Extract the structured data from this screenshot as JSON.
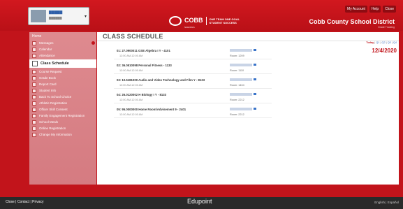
{
  "header": {
    "logo_name": "COBB",
    "logo_sub": "SCHOOLS",
    "logo_tagline": [
      "ONE TEAM ONE GOAL",
      "STUDENT SUCCESS"
    ],
    "top_links": [
      "My Account",
      "Help",
      "Close"
    ],
    "district": "Cobb County School District",
    "district_sub": "Grade Tracking"
  },
  "sidebar": {
    "home": "Home",
    "items": [
      {
        "label": "Messages",
        "icon": "envelope-icon",
        "badge": true
      },
      {
        "label": "Calendar",
        "icon": "calendar-icon"
      },
      {
        "label": "Attendance",
        "icon": "attendance-icon"
      },
      {
        "label": "Class Schedule",
        "icon": "schedule-icon",
        "active": true
      },
      {
        "label": "Course Request",
        "icon": "course-request-icon"
      },
      {
        "label": "Grade Book",
        "icon": "gradebook-icon"
      },
      {
        "label": "Report Card",
        "icon": "report-card-icon"
      },
      {
        "label": "Student Info",
        "icon": "student-icon"
      },
      {
        "label": "Back To School Choice",
        "icon": "school-choice-icon"
      },
      {
        "label": "Athletic Registration",
        "icon": "athletic-icon"
      },
      {
        "label": "Officer Skill Consent",
        "icon": "consent-icon"
      },
      {
        "label": "Family Engagement Registration",
        "icon": "family-icon"
      },
      {
        "label": "School Meals",
        "icon": "meals-icon"
      },
      {
        "label": "Online Registration",
        "icon": "registration-icon"
      },
      {
        "label": "Change My Information",
        "icon": "edit-info-icon"
      }
    ]
  },
  "main": {
    "title": "CLASS SCHEDULE",
    "periods": {
      "today": "Today",
      "sep": "|",
      "quarters": [
        "Q1",
        "Q2",
        "Q3",
        "Q4"
      ]
    },
    "date": "12/4/2020",
    "classes": [
      {
        "course": "01: 27.0900011 GSE Algebra I Y - 4101",
        "time": "12:00 AM-12:00 AM",
        "room": "Room: 1209"
      },
      {
        "course": "02: 36.0510098 Personal Fitness - 1133",
        "time": "12:00 AM-12:00 AM",
        "room": "Room: 1110"
      },
      {
        "course": "03: 10.5181000 Audio and Video Technology and Film Y - 8133",
        "time": "12:00 AM-12:00 AM",
        "room": "Room: 1404"
      },
      {
        "course": "04: 26.0120002 H Biology I Y - 8133",
        "time": "12:00 AM-12:00 AM",
        "room": "Room: 2212"
      },
      {
        "course": "05: 95.0000000 Home Room/Advisement 9 - 2401",
        "time": "12:00 AM-12:00 AM",
        "room": "Room: 2212"
      }
    ]
  },
  "footer": {
    "left": "Close | Contact | Privacy",
    "brand": "Edupoint",
    "right": "English | Español"
  }
}
